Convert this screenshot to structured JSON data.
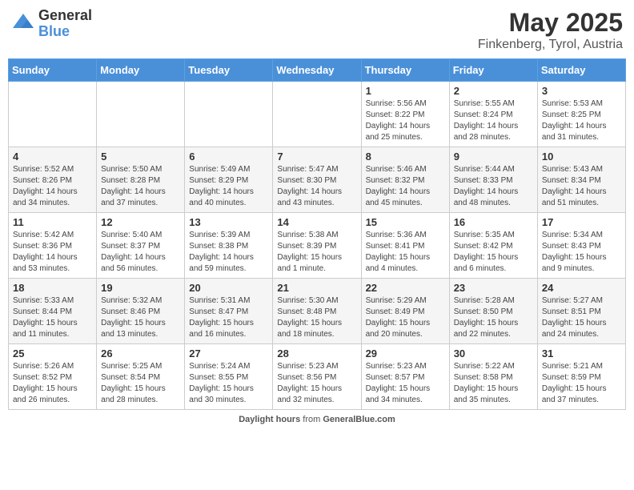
{
  "header": {
    "logo_general": "General",
    "logo_blue": "Blue",
    "title": "May 2025",
    "location": "Finkenberg, Tyrol, Austria"
  },
  "days_of_week": [
    "Sunday",
    "Monday",
    "Tuesday",
    "Wednesday",
    "Thursday",
    "Friday",
    "Saturday"
  ],
  "weeks": [
    [
      {
        "day": "",
        "info": ""
      },
      {
        "day": "",
        "info": ""
      },
      {
        "day": "",
        "info": ""
      },
      {
        "day": "",
        "info": ""
      },
      {
        "day": "1",
        "info": "Sunrise: 5:56 AM\nSunset: 8:22 PM\nDaylight: 14 hours\nand 25 minutes."
      },
      {
        "day": "2",
        "info": "Sunrise: 5:55 AM\nSunset: 8:24 PM\nDaylight: 14 hours\nand 28 minutes."
      },
      {
        "day": "3",
        "info": "Sunrise: 5:53 AM\nSunset: 8:25 PM\nDaylight: 14 hours\nand 31 minutes."
      }
    ],
    [
      {
        "day": "4",
        "info": "Sunrise: 5:52 AM\nSunset: 8:26 PM\nDaylight: 14 hours\nand 34 minutes."
      },
      {
        "day": "5",
        "info": "Sunrise: 5:50 AM\nSunset: 8:28 PM\nDaylight: 14 hours\nand 37 minutes."
      },
      {
        "day": "6",
        "info": "Sunrise: 5:49 AM\nSunset: 8:29 PM\nDaylight: 14 hours\nand 40 minutes."
      },
      {
        "day": "7",
        "info": "Sunrise: 5:47 AM\nSunset: 8:30 PM\nDaylight: 14 hours\nand 43 minutes."
      },
      {
        "day": "8",
        "info": "Sunrise: 5:46 AM\nSunset: 8:32 PM\nDaylight: 14 hours\nand 45 minutes."
      },
      {
        "day": "9",
        "info": "Sunrise: 5:44 AM\nSunset: 8:33 PM\nDaylight: 14 hours\nand 48 minutes."
      },
      {
        "day": "10",
        "info": "Sunrise: 5:43 AM\nSunset: 8:34 PM\nDaylight: 14 hours\nand 51 minutes."
      }
    ],
    [
      {
        "day": "11",
        "info": "Sunrise: 5:42 AM\nSunset: 8:36 PM\nDaylight: 14 hours\nand 53 minutes."
      },
      {
        "day": "12",
        "info": "Sunrise: 5:40 AM\nSunset: 8:37 PM\nDaylight: 14 hours\nand 56 minutes."
      },
      {
        "day": "13",
        "info": "Sunrise: 5:39 AM\nSunset: 8:38 PM\nDaylight: 14 hours\nand 59 minutes."
      },
      {
        "day": "14",
        "info": "Sunrise: 5:38 AM\nSunset: 8:39 PM\nDaylight: 15 hours\nand 1 minute."
      },
      {
        "day": "15",
        "info": "Sunrise: 5:36 AM\nSunset: 8:41 PM\nDaylight: 15 hours\nand 4 minutes."
      },
      {
        "day": "16",
        "info": "Sunrise: 5:35 AM\nSunset: 8:42 PM\nDaylight: 15 hours\nand 6 minutes."
      },
      {
        "day": "17",
        "info": "Sunrise: 5:34 AM\nSunset: 8:43 PM\nDaylight: 15 hours\nand 9 minutes."
      }
    ],
    [
      {
        "day": "18",
        "info": "Sunrise: 5:33 AM\nSunset: 8:44 PM\nDaylight: 15 hours\nand 11 minutes."
      },
      {
        "day": "19",
        "info": "Sunrise: 5:32 AM\nSunset: 8:46 PM\nDaylight: 15 hours\nand 13 minutes."
      },
      {
        "day": "20",
        "info": "Sunrise: 5:31 AM\nSunset: 8:47 PM\nDaylight: 15 hours\nand 16 minutes."
      },
      {
        "day": "21",
        "info": "Sunrise: 5:30 AM\nSunset: 8:48 PM\nDaylight: 15 hours\nand 18 minutes."
      },
      {
        "day": "22",
        "info": "Sunrise: 5:29 AM\nSunset: 8:49 PM\nDaylight: 15 hours\nand 20 minutes."
      },
      {
        "day": "23",
        "info": "Sunrise: 5:28 AM\nSunset: 8:50 PM\nDaylight: 15 hours\nand 22 minutes."
      },
      {
        "day": "24",
        "info": "Sunrise: 5:27 AM\nSunset: 8:51 PM\nDaylight: 15 hours\nand 24 minutes."
      }
    ],
    [
      {
        "day": "25",
        "info": "Sunrise: 5:26 AM\nSunset: 8:52 PM\nDaylight: 15 hours\nand 26 minutes."
      },
      {
        "day": "26",
        "info": "Sunrise: 5:25 AM\nSunset: 8:54 PM\nDaylight: 15 hours\nand 28 minutes."
      },
      {
        "day": "27",
        "info": "Sunrise: 5:24 AM\nSunset: 8:55 PM\nDaylight: 15 hours\nand 30 minutes."
      },
      {
        "day": "28",
        "info": "Sunrise: 5:23 AM\nSunset: 8:56 PM\nDaylight: 15 hours\nand 32 minutes."
      },
      {
        "day": "29",
        "info": "Sunrise: 5:23 AM\nSunset: 8:57 PM\nDaylight: 15 hours\nand 34 minutes."
      },
      {
        "day": "30",
        "info": "Sunrise: 5:22 AM\nSunset: 8:58 PM\nDaylight: 15 hours\nand 35 minutes."
      },
      {
        "day": "31",
        "info": "Sunrise: 5:21 AM\nSunset: 8:59 PM\nDaylight: 15 hours\nand 37 minutes."
      }
    ]
  ],
  "footer": {
    "label": "Daylight hours",
    "source": "GeneralBlue.com"
  }
}
